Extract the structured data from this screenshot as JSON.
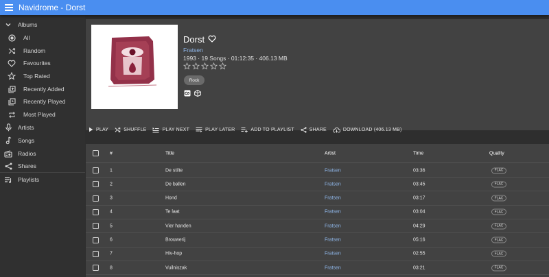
{
  "app": {
    "title": "Navidrome - Dorst"
  },
  "sidebar": {
    "albums_label": "Albums",
    "album_items": [
      {
        "label": "All",
        "icon": "radio-dot-icon"
      },
      {
        "label": "Random",
        "icon": "shuffle-icon"
      },
      {
        "label": "Favourites",
        "icon": "heart-icon"
      },
      {
        "label": "Top Rated",
        "icon": "star-icon"
      },
      {
        "label": "Recently Added",
        "icon": "library-add-icon"
      },
      {
        "label": "Recently Played",
        "icon": "library-play-icon"
      },
      {
        "label": "Most Played",
        "icon": "repeat-icon"
      }
    ],
    "items": [
      {
        "label": "Artists",
        "icon": "microphone-icon"
      },
      {
        "label": "Songs",
        "icon": "music-note-icon"
      },
      {
        "label": "Radios",
        "icon": "radio-icon"
      },
      {
        "label": "Shares",
        "icon": "share-icon"
      }
    ],
    "playlists_label": "Playlists"
  },
  "album": {
    "title": "Dorst",
    "artist": "Fratsen",
    "meta": "1993 · 19 Songs · 01:12:35 · 406.13 MB",
    "rating": 0,
    "genre": "Rock"
  },
  "toolbar": {
    "play": "PLAY",
    "shuffle": "SHUFFLE",
    "play_next": "PLAY NEXT",
    "play_later": "PLAY LATER",
    "add_to_playlist": "ADD TO PLAYLIST",
    "share": "SHARE",
    "download": "DOWNLOAD (406.13 MB)"
  },
  "table": {
    "headers": {
      "num": "#",
      "title": "Title",
      "artist": "Artist",
      "time": "Time",
      "quality": "Quality"
    },
    "rows": [
      {
        "num": "1",
        "title": "De stilte",
        "artist": "Fratsen",
        "time": "03:36",
        "quality": "FLAC"
      },
      {
        "num": "2",
        "title": "De ballen",
        "artist": "Fratsen",
        "time": "03:45",
        "quality": "FLAC"
      },
      {
        "num": "3",
        "title": "Hond",
        "artist": "Fratsen",
        "time": "03:17",
        "quality": "FLAC"
      },
      {
        "num": "4",
        "title": "Te laat",
        "artist": "Fratsen",
        "time": "03:04",
        "quality": "FLAC"
      },
      {
        "num": "5",
        "title": "Vier handen",
        "artist": "Fratsen",
        "time": "04:29",
        "quality": "FLAC"
      },
      {
        "num": "6",
        "title": "Brouwerij",
        "artist": "Fratsen",
        "time": "05:16",
        "quality": "FLAC"
      },
      {
        "num": "7",
        "title": "Hiv-hop",
        "artist": "Fratsen",
        "time": "02:55",
        "quality": "FLAC"
      },
      {
        "num": "8",
        "title": "Vuilniszak",
        "artist": "Fratsen",
        "time": "03:21",
        "quality": "FLAC"
      }
    ]
  },
  "colors": {
    "appbar": "#4a8ef0",
    "link": "#8fb6e8",
    "cover_art": "#8a1f3a"
  }
}
